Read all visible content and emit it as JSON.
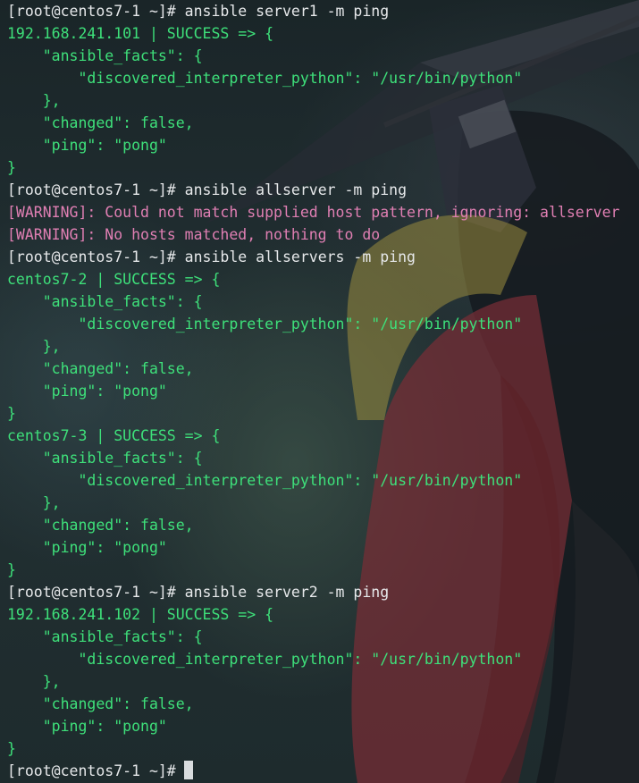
{
  "terminal": {
    "prompt": "[root@centos7-1 ~]#",
    "lines": [
      {
        "type": "cmd",
        "text": "ansible server1 -m ping"
      },
      {
        "type": "ok",
        "text": "192.168.241.101 | SUCCESS => {"
      },
      {
        "type": "ok",
        "text": "    \"ansible_facts\": {"
      },
      {
        "type": "ok",
        "text": "        \"discovered_interpreter_python\": \"/usr/bin/python\""
      },
      {
        "type": "ok",
        "text": "    },"
      },
      {
        "type": "ok",
        "text": "    \"changed\": false,"
      },
      {
        "type": "ok",
        "text": "    \"ping\": \"pong\""
      },
      {
        "type": "ok",
        "text": "}"
      },
      {
        "type": "cmd",
        "text": "ansible allserver -m ping"
      },
      {
        "type": "warn",
        "text": "[WARNING]: Could not match supplied host pattern, ignoring: allserver"
      },
      {
        "type": "warn",
        "text": "[WARNING]: No hosts matched, nothing to do"
      },
      {
        "type": "cmd",
        "text": "ansible allservers -m ping"
      },
      {
        "type": "ok",
        "text": "centos7-2 | SUCCESS => {"
      },
      {
        "type": "ok",
        "text": "    \"ansible_facts\": {"
      },
      {
        "type": "ok",
        "text": "        \"discovered_interpreter_python\": \"/usr/bin/python\""
      },
      {
        "type": "ok",
        "text": "    },"
      },
      {
        "type": "ok",
        "text": "    \"changed\": false,"
      },
      {
        "type": "ok",
        "text": "    \"ping\": \"pong\""
      },
      {
        "type": "ok",
        "text": "}"
      },
      {
        "type": "ok",
        "text": "centos7-3 | SUCCESS => {"
      },
      {
        "type": "ok",
        "text": "    \"ansible_facts\": {"
      },
      {
        "type": "ok",
        "text": "        \"discovered_interpreter_python\": \"/usr/bin/python\""
      },
      {
        "type": "ok",
        "text": "    },"
      },
      {
        "type": "ok",
        "text": "    \"changed\": false,"
      },
      {
        "type": "ok",
        "text": "    \"ping\": \"pong\""
      },
      {
        "type": "ok",
        "text": "}"
      },
      {
        "type": "cmd",
        "text": "ansible server2 -m ping"
      },
      {
        "type": "ok",
        "text": "192.168.241.102 | SUCCESS => {"
      },
      {
        "type": "ok",
        "text": "    \"ansible_facts\": {"
      },
      {
        "type": "ok",
        "text": "        \"discovered_interpreter_python\": \"/usr/bin/python\""
      },
      {
        "type": "ok",
        "text": "    },"
      },
      {
        "type": "ok",
        "text": "    \"changed\": false,"
      },
      {
        "type": "ok",
        "text": "    \"ping\": \"pong\""
      },
      {
        "type": "ok",
        "text": "}"
      },
      {
        "type": "cmd",
        "text": ""
      }
    ]
  },
  "colors": {
    "success": "#3ee07a",
    "warning": "#e07fb3",
    "text": "#e6e8ea",
    "background": "#1d2a2c"
  },
  "icons": {
    "cursor": "block-cursor-icon"
  }
}
